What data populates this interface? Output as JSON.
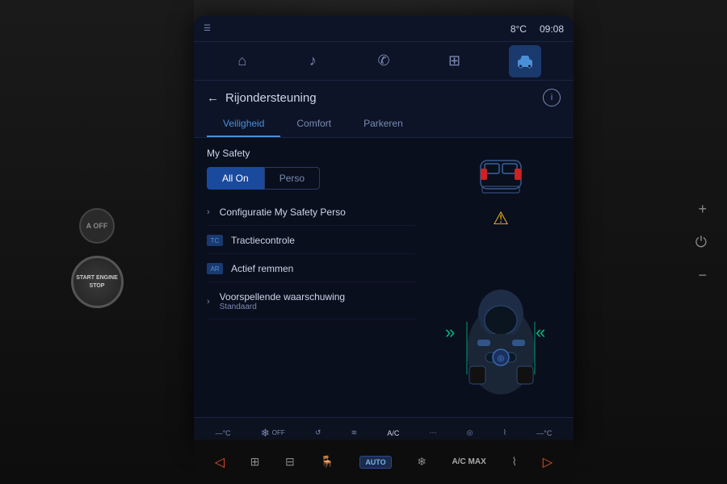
{
  "status_bar": {
    "left_icon": "☰",
    "temperature": "8°C",
    "time": "09:08"
  },
  "nav_icons": [
    {
      "id": "home",
      "symbol": "⌂",
      "active": false
    },
    {
      "id": "music",
      "symbol": "♫",
      "active": false
    },
    {
      "id": "phone",
      "symbol": "✆",
      "active": false
    },
    {
      "id": "apps",
      "symbol": "⊞",
      "active": false
    },
    {
      "id": "car",
      "symbol": "🚗",
      "active": true
    }
  ],
  "header": {
    "back_label": "←",
    "title": "Rijondersteuning",
    "info_label": "i"
  },
  "tabs": [
    {
      "id": "veiligheid",
      "label": "Veiligheid",
      "active": true
    },
    {
      "id": "comfort",
      "label": "Comfort",
      "active": false
    },
    {
      "id": "parkeren",
      "label": "Parkeren",
      "active": false
    }
  ],
  "my_safety": {
    "title": "My Safety",
    "all_on_label": "All On",
    "perso_label": "Perso"
  },
  "menu_items": [
    {
      "id": "configuratie",
      "has_chevron": true,
      "has_icon": false,
      "text": "Configuratie My Safety Perso",
      "sub": ""
    },
    {
      "id": "tractiecontrole",
      "has_chevron": false,
      "has_icon": true,
      "text": "Tractiecontrole",
      "sub": ""
    },
    {
      "id": "actief-remmen",
      "has_chevron": false,
      "has_icon": true,
      "text": "Actief remmen",
      "sub": ""
    },
    {
      "id": "voorspellende",
      "has_chevron": true,
      "has_icon": false,
      "text": "Voorspellende waarschuwing",
      "sub": "Standaard"
    }
  ],
  "bottom_bar": [
    {
      "id": "temp-left",
      "icon": "—",
      "text": "—°C"
    },
    {
      "id": "fan",
      "icon": "❄",
      "text": ""
    },
    {
      "id": "recycle",
      "icon": "↺",
      "text": ""
    },
    {
      "id": "seat-heat",
      "icon": "≋",
      "text": ""
    },
    {
      "id": "ac",
      "icon": "",
      "text": "A/C"
    },
    {
      "id": "seat-cool",
      "icon": "⋯",
      "text": ""
    },
    {
      "id": "steering",
      "icon": "◎",
      "text": ""
    },
    {
      "id": "wiper",
      "icon": "⌇",
      "text": ""
    },
    {
      "id": "temp-right",
      "icon": "—",
      "text": "—°C"
    }
  ],
  "bottom_physical": [
    {
      "id": "arrow-left",
      "symbol": "◁",
      "text": ""
    },
    {
      "id": "defrost-front",
      "symbol": "⊟",
      "text": ""
    },
    {
      "id": "defrost-rear",
      "symbol": "⊟",
      "text": ""
    },
    {
      "id": "seat1",
      "symbol": "☰",
      "text": ""
    },
    {
      "id": "auto",
      "text": "AUTO"
    },
    {
      "id": "fan2",
      "symbol": "❄",
      "text": ""
    },
    {
      "id": "ac-max",
      "text": "A/C MAX"
    },
    {
      "id": "wiper2",
      "symbol": "⌇",
      "text": ""
    },
    {
      "id": "arrow-right",
      "symbol": "▷",
      "text": ""
    }
  ],
  "side_controls": {
    "plus_label": "+",
    "power_label": "⏻",
    "minus_label": "−"
  },
  "start_button": {
    "a_off_label": "A\nOFF",
    "start_label": "START\nENGINE\nSTOP"
  }
}
